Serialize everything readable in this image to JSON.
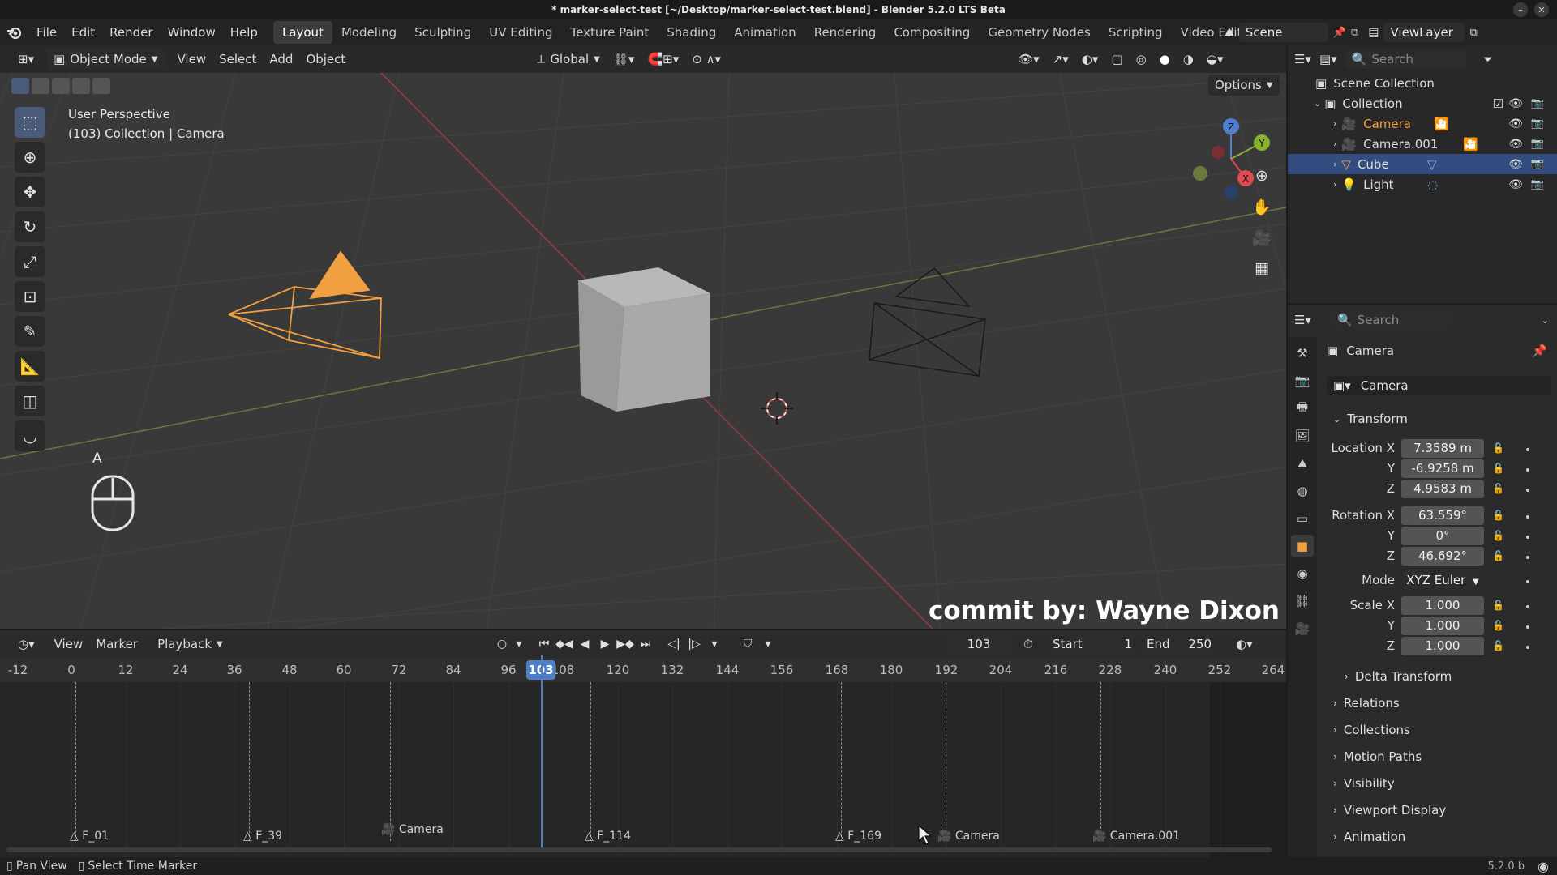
{
  "title_bar": {
    "text": "* marker-select-test [~/Desktop/marker-select-test.blend] - Blender 5.2.0 LTS Beta"
  },
  "menus": [
    "File",
    "Edit",
    "Render",
    "Window",
    "Help"
  ],
  "workspaces": [
    "Layout",
    "Modeling",
    "Sculpting",
    "UV Editing",
    "Texture Paint",
    "Shading",
    "Animation",
    "Rendering",
    "Compositing",
    "Geometry Nodes",
    "Scripting",
    "Video Editing"
  ],
  "scene": {
    "label": "Scene"
  },
  "viewlayer": {
    "label": "ViewLayer"
  },
  "viewport": {
    "mode": "Object Mode",
    "menus": [
      "View",
      "Select",
      "Add",
      "Object"
    ],
    "orientation": "Global",
    "options_label": "Options",
    "perspective_label": "User Perspective",
    "context_label": "(103) Collection | Camera",
    "key_hint": "A",
    "watermark": "commit by: Wayne Dixon",
    "gizmo_axes": {
      "x": "X",
      "y": "Y",
      "z": "Z"
    }
  },
  "timeline": {
    "menus": [
      "View",
      "Marker",
      "Playback"
    ],
    "current_frame": "103",
    "start_label": "Start",
    "start": "1",
    "end_label": "End",
    "end": "250",
    "ticks": [
      "-12",
      "0",
      "12",
      "24",
      "36",
      "48",
      "60",
      "72",
      "84",
      "96",
      "108",
      "120",
      "132",
      "144",
      "156",
      "168",
      "180",
      "192",
      "204",
      "216",
      "228",
      "240",
      "252",
      "264"
    ],
    "playhead_label": "103",
    "markers": [
      {
        "label": "F_01",
        "icon": "marker-icon"
      },
      {
        "label": "F_39",
        "icon": "marker-icon"
      },
      {
        "label": "Camera",
        "icon": "camera-icon"
      },
      {
        "label": "F_114",
        "icon": "marker-icon"
      },
      {
        "label": "F_169",
        "icon": "marker-icon"
      },
      {
        "label": "Camera",
        "icon": "camera-icon"
      },
      {
        "label": "Camera.001",
        "icon": "camera-icon"
      }
    ]
  },
  "outliner": {
    "search_placeholder": "Search",
    "scene_collection": "Scene Collection",
    "collection": "Collection",
    "items": [
      {
        "label": "Camera",
        "selected": false,
        "active": true
      },
      {
        "label": "Camera.001",
        "selected": false,
        "active": false
      },
      {
        "label": "Cube",
        "selected": true,
        "active": false
      },
      {
        "label": "Light",
        "selected": false,
        "active": false
      }
    ]
  },
  "properties": {
    "search_placeholder": "Search",
    "object_name": "Camera",
    "data_name": "Camera",
    "transform_label": "Transform",
    "location_label": "Location X",
    "rotation_label": "Rotation X",
    "scale_label": "Scale X",
    "y_label": "Y",
    "z_label": "Z",
    "location": [
      "7.3589 m",
      "-6.9258 m",
      "4.9583 m"
    ],
    "rotation": [
      "63.559°",
      "0°",
      "46.692°"
    ],
    "mode_label": "Mode",
    "mode": "XYZ Euler",
    "scale": [
      "1.000",
      "1.000",
      "1.000"
    ],
    "delta_transform": "Delta Transform",
    "panels": [
      "Relations",
      "Collections",
      "Motion Paths",
      "Visibility",
      "Viewport Display",
      "Animation"
    ]
  },
  "status_bar": {
    "pan_view": "Pan View",
    "select_marker": "Select Time Marker",
    "version": "5.2.0 b"
  },
  "colors": {
    "selected_object": "#f0a040",
    "playhead": "#4e7ec8",
    "selection_row": "#334d80",
    "viewport_bg": "#393939"
  }
}
